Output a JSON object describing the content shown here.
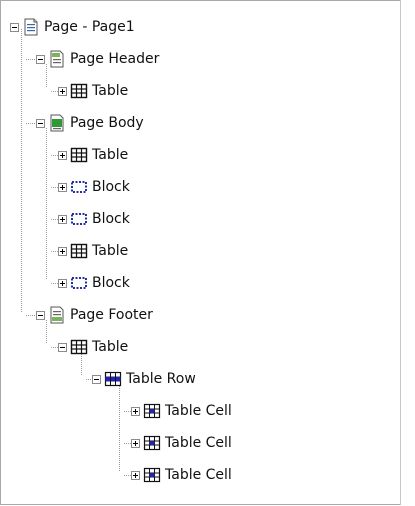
{
  "tree": {
    "root": {
      "label": "Page - Page1",
      "icon": "page-icon",
      "expanded": true
    },
    "header": {
      "label": "Page Header",
      "icon": "page-header-icon",
      "expanded": true
    },
    "header_table": {
      "label": "Table",
      "icon": "table-icon",
      "expanded": false
    },
    "body": {
      "label": "Page Body",
      "icon": "page-body-icon",
      "expanded": true
    },
    "body_items": [
      {
        "label": "Table",
        "icon": "table-icon",
        "expanded": false
      },
      {
        "label": "Block",
        "icon": "block-icon",
        "expanded": false
      },
      {
        "label": "Block",
        "icon": "block-icon",
        "expanded": false
      },
      {
        "label": "Table",
        "icon": "table-icon",
        "expanded": false
      },
      {
        "label": "Block",
        "icon": "block-icon",
        "expanded": false
      }
    ],
    "footer": {
      "label": "Page Footer",
      "icon": "page-footer-icon",
      "expanded": true
    },
    "footer_table": {
      "label": "Table",
      "icon": "table-icon",
      "expanded": true
    },
    "table_row": {
      "label": "Table Row",
      "icon": "table-row-icon",
      "expanded": true
    },
    "cells": [
      {
        "label": "Table Cell",
        "icon": "table-cell-icon",
        "expanded": false
      },
      {
        "label": "Table Cell",
        "icon": "table-cell-icon",
        "expanded": false
      },
      {
        "label": "Table Cell",
        "icon": "table-cell-icon",
        "expanded": false
      }
    ]
  }
}
